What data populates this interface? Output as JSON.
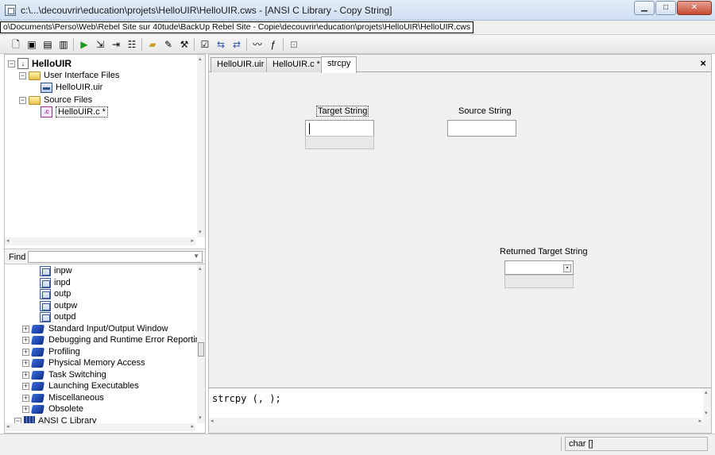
{
  "window": {
    "title": "c:\\...\\decouvrir\\education\\projets\\HelloUIR\\HelloUIR.cws - [ANSI C Library - Copy String]",
    "minimize": "▁",
    "maximize": "□",
    "close": "✕"
  },
  "path": "o\\Documents\\Perso\\Web\\Rebel Site sur 40tude\\BackUp Rebel Site - Copie\\decouvrir\\education\\projets\\HelloUIR\\HelloUIR.cws",
  "toolbar": {
    "icons": [
      "new-file-icon",
      "open-icon",
      "save-icon",
      "save-all-icon",
      "folder-open-icon",
      "run-icon",
      "step-into-icon",
      "step-over-icon",
      "watch-icon",
      "load-icon",
      "build-icon",
      "check-icon",
      "break-icon",
      "reload-icon",
      "refresh-icon",
      "browse-icon",
      "function-icon",
      "insert-icon"
    ]
  },
  "tree": {
    "project": "HelloUIR",
    "folders": [
      {
        "label": "User Interface Files",
        "files": [
          "HelloUIR.uir"
        ]
      },
      {
        "label": "Source Files",
        "files": [
          "HelloUIR.c *"
        ]
      }
    ]
  },
  "find": {
    "label": "Find",
    "value": ""
  },
  "library": {
    "functions": [
      "inpw",
      "inpd",
      "outp",
      "outpw",
      "outpd"
    ],
    "groups": [
      "Standard Input/Output Window",
      "Debugging and Runtime Error Reporting",
      "Profiling",
      "Physical Memory Access",
      "Task Switching",
      "Launching Executables",
      "Miscellaneous",
      "Obsolete"
    ],
    "ansi": "ANSI C Library"
  },
  "tabs": [
    {
      "label": "HelloUIR.uir"
    },
    {
      "label": "HelloUIR.c *"
    },
    {
      "label": "strcpy"
    }
  ],
  "tab_close": "×",
  "panel": {
    "target_label": "Target String",
    "source_label": "Source String",
    "returned_label": "Returned Target String"
  },
  "code": "strcpy (, );",
  "status": {
    "type": "char []"
  }
}
